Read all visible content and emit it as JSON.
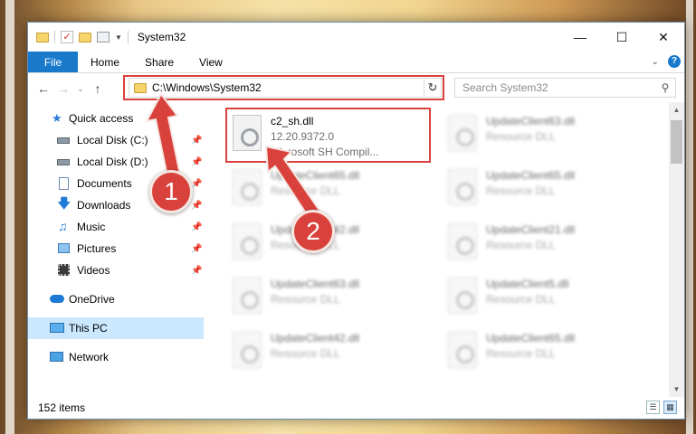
{
  "window": {
    "title": "System32"
  },
  "ribbon": {
    "tabs": [
      {
        "label": "File"
      },
      {
        "label": "Home"
      },
      {
        "label": "Share"
      },
      {
        "label": "View"
      }
    ]
  },
  "address": {
    "path": "C:\\Windows\\System32"
  },
  "search": {
    "placeholder": "Search System32"
  },
  "sidebar": {
    "items": [
      {
        "label": "Quick access",
        "icon": "star-icon"
      },
      {
        "label": "Local Disk (C:)",
        "icon": "drive-icon",
        "pinned": true
      },
      {
        "label": "Local Disk (D:)",
        "icon": "drive-icon",
        "pinned": true
      },
      {
        "label": "Documents",
        "icon": "documents-icon",
        "pinned": true
      },
      {
        "label": "Downloads",
        "icon": "download-icon",
        "pinned": true
      },
      {
        "label": "Music",
        "icon": "music-icon",
        "pinned": true
      },
      {
        "label": "Pictures",
        "icon": "pictures-icon",
        "pinned": true
      },
      {
        "label": "Videos",
        "icon": "videos-icon",
        "pinned": true
      },
      {
        "label": "OneDrive",
        "icon": "cloud-icon"
      },
      {
        "label": "This PC",
        "icon": "computer-icon",
        "selected": true
      },
      {
        "label": "Network",
        "icon": "network-icon"
      }
    ]
  },
  "files": [
    {
      "name": "c2_sh.dll",
      "line2": "12.20.9372.0",
      "line3": "Microsoft SH Compil..."
    },
    {
      "name": "UpdateClient63.dll",
      "line2": "Resource DLL"
    },
    {
      "name": "UpdateClient65.dll",
      "line2": "Resource DLL"
    },
    {
      "name": "UpdateClient65.dll",
      "line2": "Resource DLL"
    },
    {
      "name": "UpdateClient42.dll",
      "line2": "Resource DLL"
    },
    {
      "name": "UpdateClient21.dll",
      "line2": "Resource DLL"
    },
    {
      "name": "UpdateClient63.dll",
      "line2": "Resource DLL"
    },
    {
      "name": "UpdateClient5.dll",
      "line2": "Resource DLL"
    },
    {
      "name": "UpdateClient42.dll",
      "line2": "Resource DLL"
    },
    {
      "name": "UpdateClient65.dll",
      "line2": "Resource DLL"
    }
  ],
  "status": {
    "item_count": "152 items"
  },
  "callouts": [
    {
      "label": "1"
    },
    {
      "label": "2"
    }
  ],
  "colors": {
    "accent": "#1979ca",
    "highlight": "#d9423c",
    "selected": "#cce8ff"
  }
}
